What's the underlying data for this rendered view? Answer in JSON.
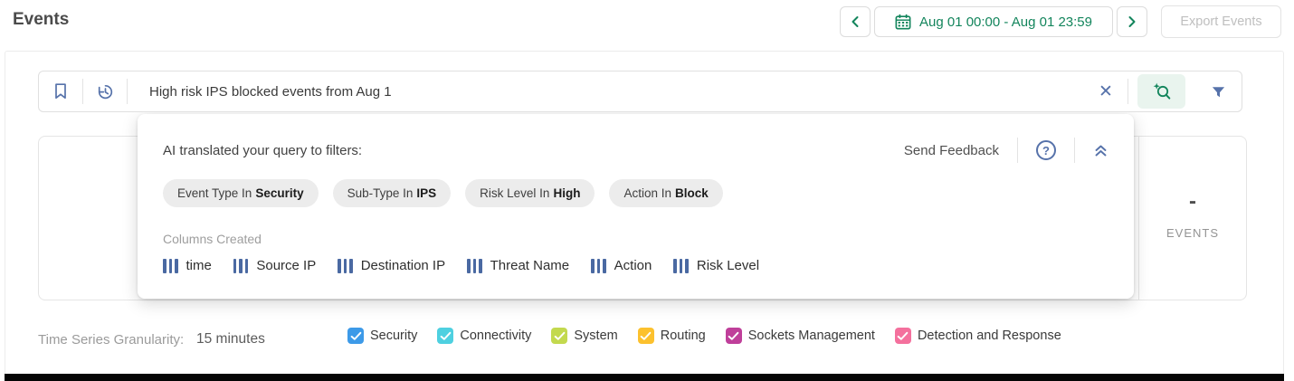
{
  "page": {
    "title": "Events"
  },
  "header": {
    "date_range": "Aug 01 00:00 - Aug 01 23:59",
    "export_label": "Export Events"
  },
  "search": {
    "query": "High risk IPS blocked events from Aug 1"
  },
  "icons": {
    "clear": "✕",
    "help": "?"
  },
  "ai_panel": {
    "title": "AI translated your query to filters:",
    "send_feedback_label": "Send Feedback",
    "filters": [
      {
        "prefix": "Event Type In",
        "value": "Security"
      },
      {
        "prefix": "Sub-Type In",
        "value": "IPS"
      },
      {
        "prefix": "Risk Level In",
        "value": "High"
      },
      {
        "prefix": "Action In",
        "value": "Block"
      }
    ],
    "columns_created_label": "Columns Created",
    "columns": [
      "time",
      "Source IP",
      "Destination IP",
      "Threat Name",
      "Action",
      "Risk Level"
    ]
  },
  "chart_panel": {
    "events_value": "-",
    "events_label": "EVENTS"
  },
  "granularity": {
    "label": "Time Series Granularity:",
    "value": "15 minutes"
  },
  "categories": [
    {
      "label": "Security",
      "color": "#3d9ae8",
      "checked": true
    },
    {
      "label": "Connectivity",
      "color": "#4ed0e0",
      "checked": true
    },
    {
      "label": "System",
      "color": "#c3d94e",
      "checked": true
    },
    {
      "label": "Routing",
      "color": "#fcc12e",
      "checked": true
    },
    {
      "label": "Sockets Management",
      "color": "#bf3f9a",
      "checked": true
    },
    {
      "label": "Detection and Response",
      "color": "#f4709d",
      "checked": true
    }
  ],
  "colors": {
    "accent_green": "#13855c",
    "icon_blue": "#5672aa",
    "chip_bg": "#ececec",
    "bottom_bar": "#050505"
  }
}
